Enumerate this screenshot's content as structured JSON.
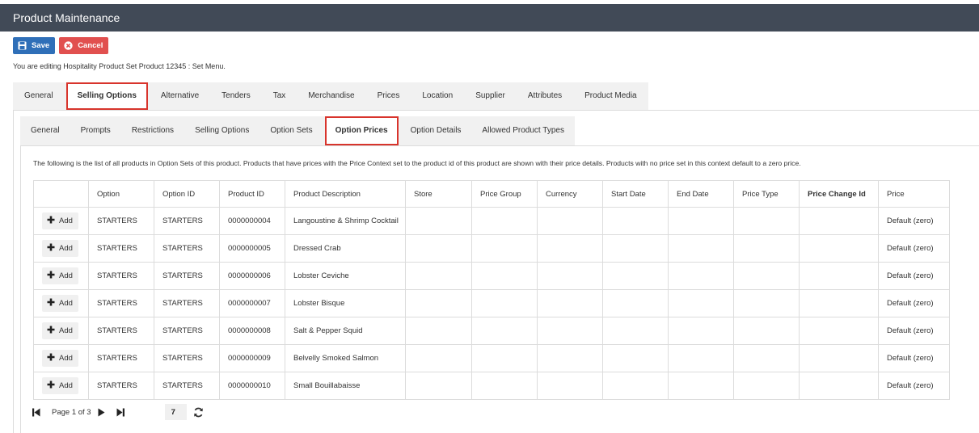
{
  "app": {
    "title": "Product Maintenance"
  },
  "toolbar": {
    "save_label": "Save",
    "cancel_label": "Cancel"
  },
  "editing_note": "You are editing Hospitality Product Set Product 12345 : Set Menu.",
  "main_tabs": [
    {
      "label": "General",
      "active": false
    },
    {
      "label": "Selling Options",
      "active": true
    },
    {
      "label": "Alternative",
      "active": false
    },
    {
      "label": "Tenders",
      "active": false
    },
    {
      "label": "Tax",
      "active": false
    },
    {
      "label": "Merchandise",
      "active": false
    },
    {
      "label": "Prices",
      "active": false
    },
    {
      "label": "Location",
      "active": false
    },
    {
      "label": "Supplier",
      "active": false
    },
    {
      "label": "Attributes",
      "active": false
    },
    {
      "label": "Product Media",
      "active": false
    }
  ],
  "sub_tabs": [
    {
      "label": "General",
      "active": false
    },
    {
      "label": "Prompts",
      "active": false
    },
    {
      "label": "Restrictions",
      "active": false
    },
    {
      "label": "Selling Options",
      "active": false
    },
    {
      "label": "Option Sets",
      "active": false
    },
    {
      "label": "Option Prices",
      "active": true
    },
    {
      "label": "Option Details",
      "active": false
    },
    {
      "label": "Allowed Product Types",
      "active": false
    }
  ],
  "info_text": "The following is the list of all products in Option Sets of this product. Products that have prices with the Price Context set to the product id of this product are shown with their price details. Products with no price set in this context default to a zero price.",
  "table": {
    "add_label": "Add",
    "columns": [
      "",
      "Option",
      "Option ID",
      "Product ID",
      "Product Description",
      "Store",
      "Price Group",
      "Currency",
      "Start Date",
      "End Date",
      "Price Type",
      "Price Change Id",
      "Price"
    ],
    "rows": [
      {
        "option": "STARTERS",
        "option_id": "STARTERS",
        "product_id": "0000000004",
        "description": "Langoustine & Shrimp Cocktail",
        "store": "",
        "price_group": "",
        "currency": "",
        "start_date": "",
        "end_date": "",
        "price_type": "",
        "price_change_id": "",
        "price": "Default (zero)"
      },
      {
        "option": "STARTERS",
        "option_id": "STARTERS",
        "product_id": "0000000005",
        "description": "Dressed Crab",
        "store": "",
        "price_group": "",
        "currency": "",
        "start_date": "",
        "end_date": "",
        "price_type": "",
        "price_change_id": "",
        "price": "Default (zero)"
      },
      {
        "option": "STARTERS",
        "option_id": "STARTERS",
        "product_id": "0000000006",
        "description": "Lobster Ceviche",
        "store": "",
        "price_group": "",
        "currency": "",
        "start_date": "",
        "end_date": "",
        "price_type": "",
        "price_change_id": "",
        "price": "Default (zero)"
      },
      {
        "option": "STARTERS",
        "option_id": "STARTERS",
        "product_id": "0000000007",
        "description": "Lobster Bisque",
        "store": "",
        "price_group": "",
        "currency": "",
        "start_date": "",
        "end_date": "",
        "price_type": "",
        "price_change_id": "",
        "price": "Default (zero)"
      },
      {
        "option": "STARTERS",
        "option_id": "STARTERS",
        "product_id": "0000000008",
        "description": "Salt & Pepper Squid",
        "store": "",
        "price_group": "",
        "currency": "",
        "start_date": "",
        "end_date": "",
        "price_type": "",
        "price_change_id": "",
        "price": "Default (zero)"
      },
      {
        "option": "STARTERS",
        "option_id": "STARTERS",
        "product_id": "0000000009",
        "description": "Belvelly Smoked Salmon",
        "store": "",
        "price_group": "",
        "currency": "",
        "start_date": "",
        "end_date": "",
        "price_type": "",
        "price_change_id": "",
        "price": "Default (zero)"
      },
      {
        "option": "STARTERS",
        "option_id": "STARTERS",
        "product_id": "0000000010",
        "description": "Small Bouillabaisse",
        "store": "",
        "price_group": "",
        "currency": "",
        "start_date": "",
        "end_date": "",
        "price_type": "",
        "price_change_id": "",
        "price": "Default (zero)"
      }
    ]
  },
  "pager": {
    "page_text": "Page 1 of 3",
    "page_size": "7"
  },
  "colors": {
    "titlebar": "#414a57",
    "save": "#2f6fb8",
    "cancel": "#e1504f",
    "active_tab_border": "#d8342c"
  },
  "icons": {
    "save": "floppy-disk-icon",
    "cancel": "x-circle-icon",
    "add": "plus-icon",
    "first": "first-page-icon",
    "next": "next-page-icon",
    "last": "last-page-icon",
    "refresh": "refresh-icon"
  }
}
